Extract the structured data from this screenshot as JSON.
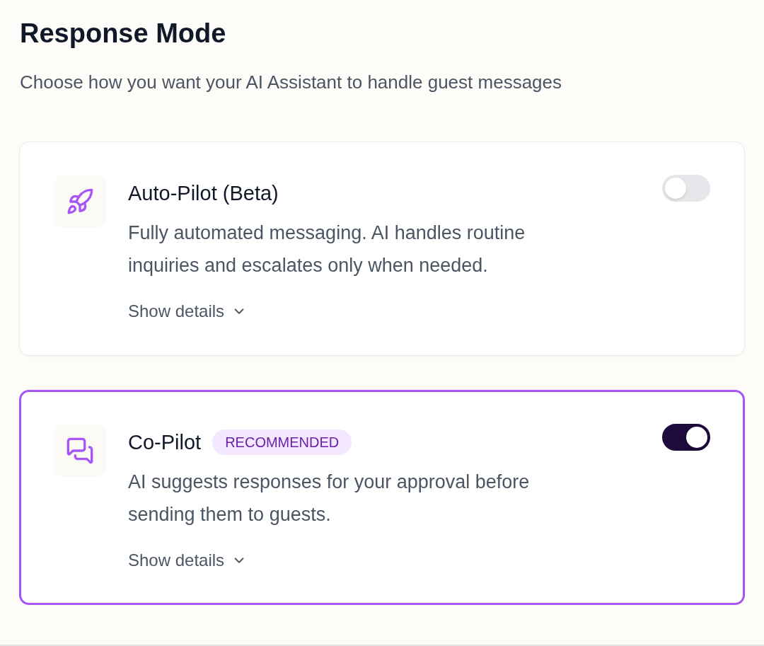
{
  "header": {
    "title": "Response Mode",
    "subtitle": "Choose how you want your AI Assistant to handle guest messages"
  },
  "modes": [
    {
      "title": "Auto-Pilot (Beta)",
      "description": "Fully automated messaging. AI handles routine inquiries and escalates only when needed.",
      "details_label": "Show details",
      "expanded": false,
      "on": false,
      "selected": false
    },
    {
      "title": "Co-Pilot",
      "badge": "RECOMMENDED",
      "description": "AI suggests responses for your approval before sending them to guests.",
      "details_label": "Show details",
      "expanded": false,
      "on": true,
      "selected": true
    }
  ]
}
